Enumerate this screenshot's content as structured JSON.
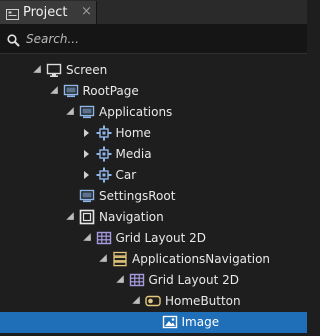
{
  "panel": {
    "tab_title": "Project",
    "tab_close": "×"
  },
  "search": {
    "placeholder": "Search...",
    "value": ""
  },
  "tree": [
    {
      "label": "Screen",
      "icon": "screen-icon",
      "level": 0,
      "state": "expanded",
      "selected": false
    },
    {
      "label": "RootPage",
      "icon": "page-icon",
      "level": 1,
      "state": "expanded",
      "selected": false
    },
    {
      "label": "Applications",
      "icon": "page-icon",
      "level": 2,
      "state": "expanded",
      "selected": false
    },
    {
      "label": "Home",
      "icon": "component-icon",
      "level": 3,
      "state": "collapsed",
      "selected": false
    },
    {
      "label": "Media",
      "icon": "component-icon",
      "level": 3,
      "state": "collapsed",
      "selected": false
    },
    {
      "label": "Car",
      "icon": "component-icon",
      "level": 3,
      "state": "collapsed",
      "selected": false
    },
    {
      "label": "SettingsRoot",
      "icon": "page-icon",
      "level": 2,
      "state": "none",
      "selected": false
    },
    {
      "label": "Navigation",
      "icon": "empty-node-icon",
      "level": 2,
      "state": "expanded",
      "selected": false
    },
    {
      "label": "Grid Layout 2D",
      "icon": "grid-layout-icon",
      "level": 3,
      "state": "expanded",
      "selected": false
    },
    {
      "label": "ApplicationsNavigation",
      "icon": "list-icon",
      "level": 4,
      "state": "expanded",
      "selected": false
    },
    {
      "label": "Grid Layout 2D",
      "icon": "grid-layout-icon",
      "level": 5,
      "state": "expanded",
      "selected": false
    },
    {
      "label": "HomeButton",
      "icon": "button-icon",
      "level": 6,
      "state": "expanded",
      "selected": false
    },
    {
      "label": "Image",
      "icon": "image-icon",
      "level": 7,
      "state": "none",
      "selected": true
    }
  ],
  "colors": {
    "background": "#1e1e1e",
    "selection": "#1f6fb8",
    "icon_blue": "#8fb6e8",
    "icon_purple": "#a59be0",
    "icon_yellow": "#e3c77a"
  }
}
